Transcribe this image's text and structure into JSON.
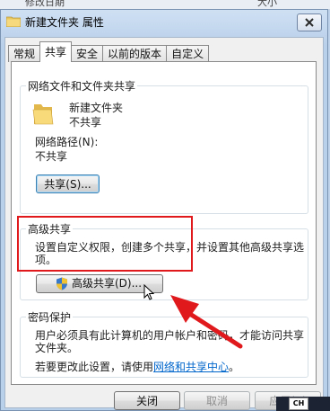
{
  "background_strip": {
    "left_text": "修改日期",
    "right_text": "大小"
  },
  "window": {
    "title": "新建文件夹 属性"
  },
  "tabs": [
    {
      "label": "常规"
    },
    {
      "label": "共享",
      "active": true
    },
    {
      "label": "安全"
    },
    {
      "label": "以前的版本"
    },
    {
      "label": "自定义"
    }
  ],
  "network_sharing": {
    "group_title": "网络文件和文件夹共享",
    "folder_name": "新建文件夹",
    "folder_status": "不共享",
    "path_label": "网络路径(N):",
    "path_value": "不共享",
    "share_button": "共享(S)..."
  },
  "advanced_sharing": {
    "group_title": "高级共享",
    "description_line1": "设置自定义权限，创建多个共享，并设置其他高级共享选",
    "description_line2": "项。",
    "button_label": "高级共享(D)..."
  },
  "password_protection": {
    "group_title": "密码保护",
    "description_line1": "用户必须具有此计算机的用户帐户和密码，才能访问共享",
    "description_line2": "文件夹。",
    "change_prefix": "若要更改此设置，请使用",
    "link_text": "网络和共享中心",
    "change_suffix": "。"
  },
  "buttons": {
    "close": "关闭",
    "cancel": "取消",
    "apply": "应用(A)"
  },
  "tray": {
    "ime": "CH"
  },
  "colors": {
    "annotation_red": "#e0191d",
    "link_blue": "#0066cc",
    "window_frame": "#b9d0ea"
  }
}
